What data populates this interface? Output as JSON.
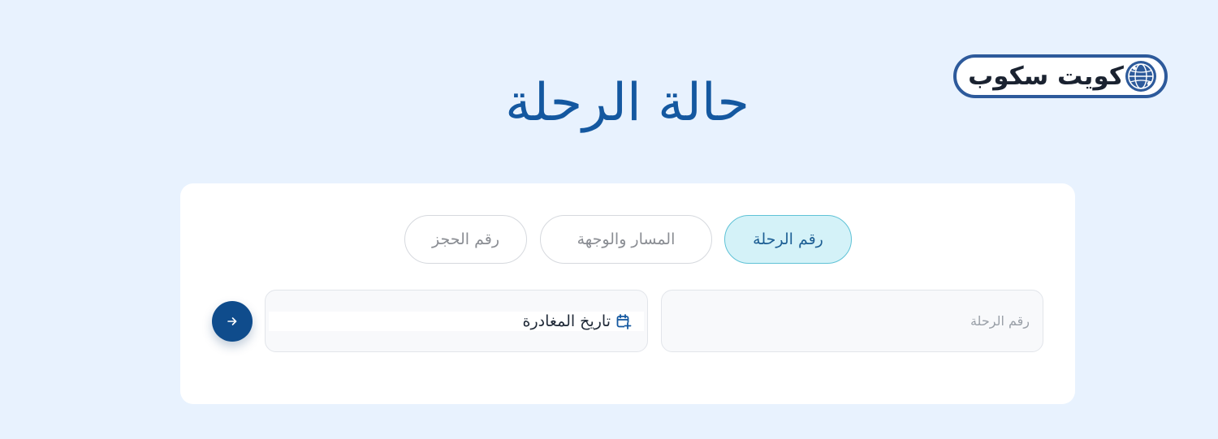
{
  "brand": {
    "logo_text": "كويت سكوب",
    "logo_icon": "globe-icon"
  },
  "page": {
    "title": "حالة الرحلة"
  },
  "tabs": [
    {
      "label": "رقم الرحلة",
      "active": true
    },
    {
      "label": "المسار والوجهة",
      "active": false
    },
    {
      "label": "رقم الحجز",
      "active": false
    }
  ],
  "form": {
    "flight_number_placeholder": "رقم الرحلة",
    "departure_date_label": "تاريخ المغادرة",
    "date_icon": "calendar-plus-icon",
    "submit_icon": "arrow-right-icon"
  },
  "colors": {
    "background": "#e8f2fe",
    "title": "#1458a0",
    "active_tab_bg": "#d4f2f8",
    "active_tab_border": "#5fc2d6",
    "submit_button": "#0f4c8c",
    "logo_border": "#2d5a9b"
  }
}
